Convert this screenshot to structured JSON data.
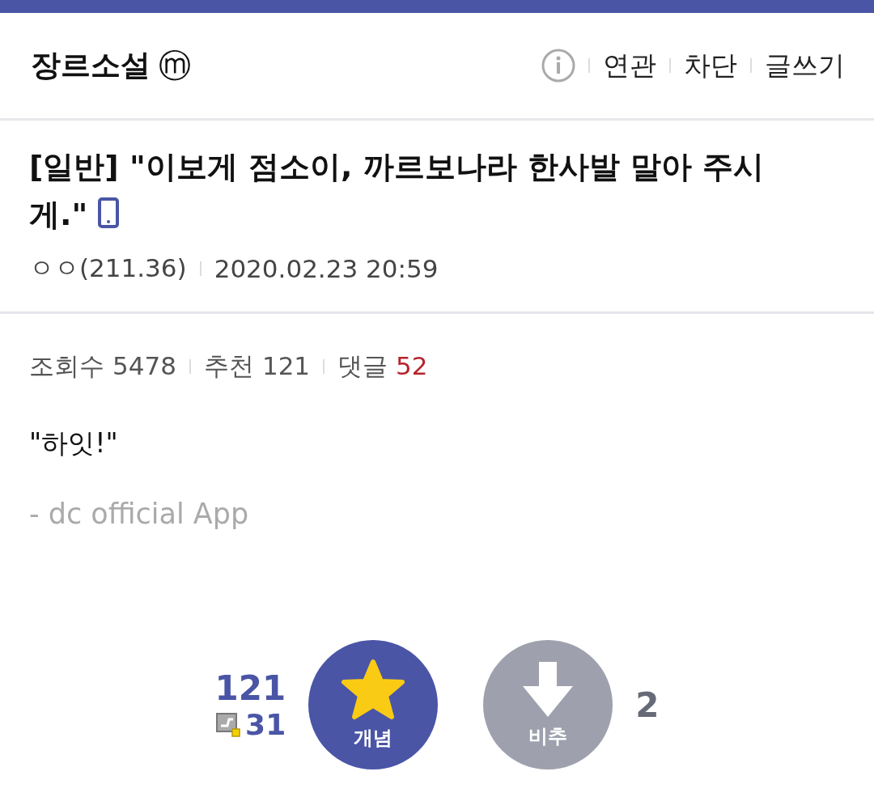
{
  "header": {
    "gallery_name": "장르소설",
    "badge": "ⓜ",
    "actions": [
      "연관",
      "차단",
      "글쓰기"
    ]
  },
  "post": {
    "category": "[일반]",
    "title": "\"이보게 점소이, 까르보나라 한사발 말아 주시게.\"",
    "author": "ㅇㅇ(211.36)",
    "date": "2020.02.23 20:59",
    "stats": [
      {
        "label": "조회수",
        "value": "5478",
        "highlight": false
      },
      {
        "label": "추천",
        "value": "121",
        "highlight": false
      },
      {
        "label": "댓글",
        "value": "52",
        "highlight": true
      }
    ],
    "body": "\"하잇!\"",
    "signature": "- dc official App"
  },
  "votes": {
    "up_count": "121",
    "fixed_count": "31",
    "up_label": "개념",
    "down_label": "비추",
    "down_count": "2"
  }
}
